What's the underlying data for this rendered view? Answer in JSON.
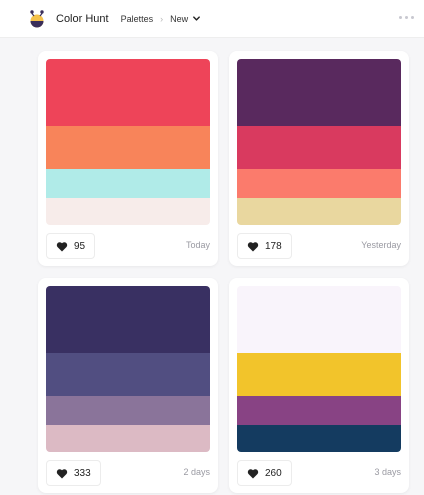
{
  "header": {
    "brand": "Color Hunt",
    "crumb": "Palettes",
    "separator": "›",
    "sort_label": "New",
    "logo_colors": [
      "#3a2e5a",
      "#f5c24b",
      "#e8456a",
      "#2ec4d6"
    ]
  },
  "palettes": [
    {
      "colors": [
        "#ee4459",
        "#f8845a",
        "#b0ebe8",
        "#f7ecea"
      ],
      "likes": "95",
      "date": "Today"
    },
    {
      "colors": [
        "#59295e",
        "#d93a5f",
        "#fb7b6c",
        "#e9d79f"
      ],
      "likes": "178",
      "date": "Yesterday"
    },
    {
      "colors": [
        "#393062",
        "#514e81",
        "#8a749a",
        "#dcbac4"
      ],
      "likes": "333",
      "date": "2 days"
    },
    {
      "colors": [
        "#f9f4fb",
        "#f2c42b",
        "#884384",
        "#143b60"
      ],
      "likes": "260",
      "date": "3 days"
    }
  ],
  "icons": {
    "like": "heart-icon",
    "more": "more-dots-icon",
    "sort": "chevron-down-icon",
    "logo": "color-hunt-logo-icon"
  }
}
